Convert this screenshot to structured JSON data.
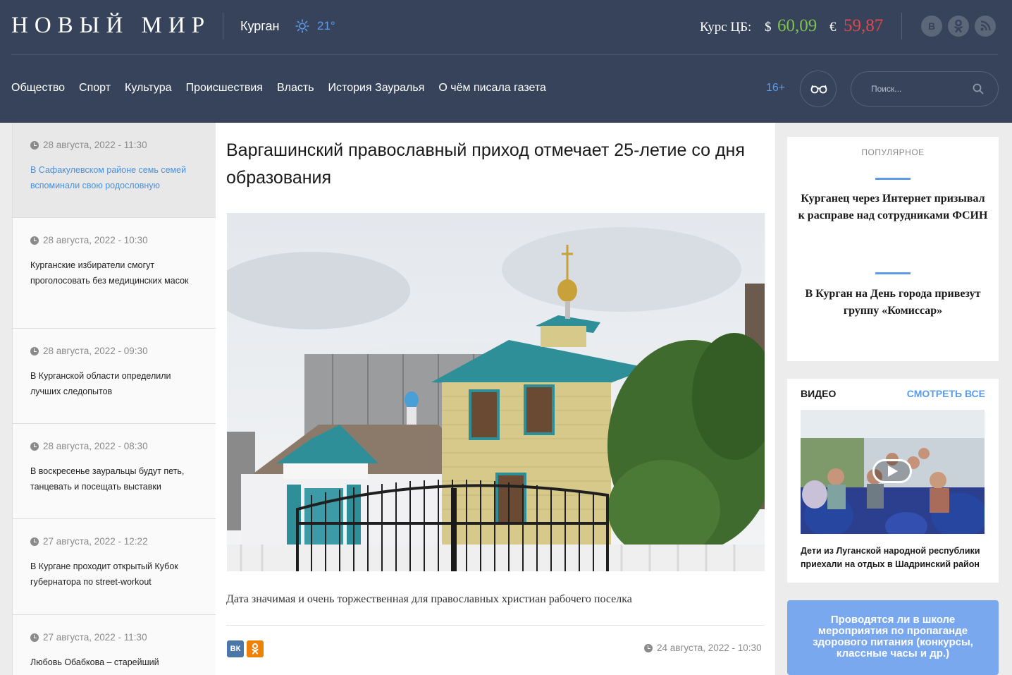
{
  "header": {
    "logo": "НОВЫЙ МИР",
    "city": "Курган",
    "temperature": "21°",
    "rates": {
      "label": "Курс ЦБ:",
      "usd_symbol": "$",
      "usd_value": "60,09",
      "eur_symbol": "€",
      "eur_value": "59,87"
    },
    "social": [
      {
        "icon": "vk-icon",
        "glyph": "В"
      },
      {
        "icon": "odnoklassniki-icon",
        "glyph": "ОК"
      },
      {
        "icon": "rss-icon",
        "glyph": "RSS"
      }
    ],
    "nav": [
      "Общество",
      "Спорт",
      "Культура",
      "Происшествия",
      "Власть",
      "История Зауралья",
      "О чём писала газета"
    ],
    "age_rating": "16+",
    "search_placeholder": "Поиск..."
  },
  "feed": [
    {
      "time": "28 августа, 2022 - 11:30",
      "title": "В Сафакулевском районе семь семей вспоминали свою родословную",
      "active": true
    },
    {
      "time": "28 августа, 2022 - 10:30",
      "title": "Курганские избиратели смогут проголосовать без медицинских масок"
    },
    {
      "time": "28 августа, 2022 - 09:30",
      "title": "В Курганской области определили лучших следопытов"
    },
    {
      "time": "28 августа, 2022 - 08:30",
      "title": "В воскресенье зауральцы будут петь, танцевать и посещать выставки"
    },
    {
      "time": "27 августа, 2022 - 12:22",
      "title": "В Кургане проходит открытый Кубок губернатора по street-workout"
    },
    {
      "time": "27 августа, 2022 - 11:30",
      "title": "Любовь Обабкова – старейший"
    }
  ],
  "article": {
    "title": "Варгашинский православный приход отмечает 25-летие со дня образования",
    "lead": "Дата значимая и очень торжественная для православных христиан рабочего поселка",
    "date": "24 августа, 2022 - 10:30",
    "share": {
      "vk": "ВК",
      "ok": "ОК"
    }
  },
  "popular": {
    "heading": "ПОПУЛЯРНОЕ",
    "items": [
      "Курганец через Интернет призывал к расправе над сотрудниками ФСИН",
      "В Курган на День города привезут группу «Комиссар»"
    ]
  },
  "video": {
    "heading": "ВИДЕО",
    "see_all": "СМОТРЕТЬ ВСЕ",
    "title": "Дети из Луганской народной республики приехали на отдых в Шадринский район"
  },
  "poll": {
    "question": "Проводятся ли в школе мероприятия по пропаганде здорового питания (конкурсы, классные часы и др.)"
  },
  "colors": {
    "header_bg": "#37435a",
    "accent": "#5b9bea",
    "usd": "#7cc24f",
    "eur": "#e0474c",
    "poll_bg": "#7aa8ef"
  }
}
